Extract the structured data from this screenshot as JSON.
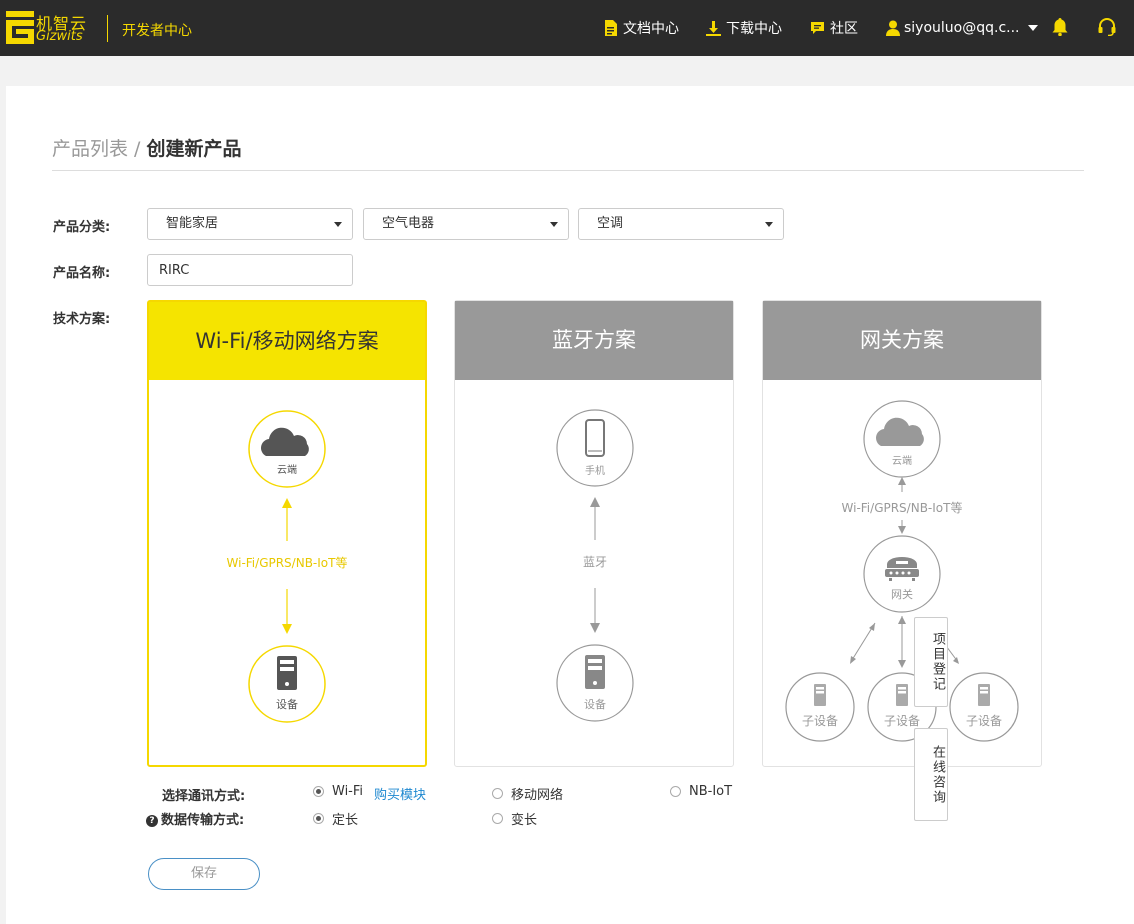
{
  "nav": {
    "logo_cn": "机智云",
    "logo_en": "Gizwits",
    "dev_center": "开发者中心",
    "docs": "文档中心",
    "downloads": "下载中心",
    "community": "社区",
    "user": "siyouluo@qq.c...",
    "accent_color": "#f5d800"
  },
  "breadcrumb": {
    "parent": "产品列表",
    "separator": " / ",
    "current": "创建新产品"
  },
  "form": {
    "category_label": "产品分类:",
    "category_1": "智能家居",
    "category_2": "空气电器",
    "category_3": "空调",
    "name_label": "产品名称:",
    "name_value": "RIRC",
    "tech_label": "技术方案:"
  },
  "cards": {
    "wifi": {
      "title": "Wi-Fi/移动网络方案",
      "cloud": "云端",
      "link": "Wi-Fi/GPRS/NB-IoT等",
      "device": "设备"
    },
    "bluetooth": {
      "title": "蓝牙方案",
      "phone": "手机",
      "link": "蓝牙",
      "device": "设备"
    },
    "gateway": {
      "title": "网关方案",
      "cloud": "云端",
      "link": "Wi-Fi/GPRS/NB-IoT等",
      "gateway": "网关",
      "sub1": "子设备",
      "sub2": "子设备",
      "sub3": "子设备"
    }
  },
  "options": {
    "comm_label": "选择通讯方式:",
    "comm_wifi": "Wi-Fi",
    "buy_module": "购买模块",
    "comm_mobile": "移动网络",
    "comm_nbiot": "NB-IoT",
    "transfer_label": "数据传输方式:",
    "fixed": "定长",
    "variable": "变长"
  },
  "save": "保存",
  "float": {
    "register": "项目登记",
    "consult": "在线咨询"
  }
}
